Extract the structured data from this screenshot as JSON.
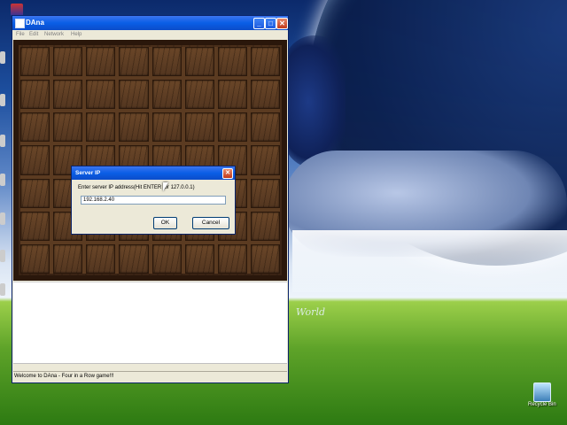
{
  "window": {
    "title": "DAna",
    "menus": [
      "File",
      "Edit",
      "Network",
      "Help"
    ],
    "status_text": "Welcome to DAna - Four in a Row game!!!"
  },
  "board": {
    "columns": 8,
    "rows": 7
  },
  "dialog": {
    "title": "Server IP",
    "prompt": "Enter server IP address(Hit ENTER for 127.0.0.1)",
    "input_value": "192.168.2.40",
    "ok_label": "OK",
    "cancel_label": "Cancel",
    "close_glyph": "✕"
  },
  "desktop": {
    "wallpaper_text": "World",
    "recycle_bin_label": "Recycle Bin"
  },
  "icons": {
    "app": "app-icon",
    "minimize": "minimize-icon",
    "maximize": "maximize-icon",
    "close": "close-icon",
    "recycle": "recycle-bin-icon"
  },
  "colors": {
    "titlebar": "#0a5ee6",
    "board_wood": "#5b3b21",
    "window_bg": "#ece9d8"
  }
}
